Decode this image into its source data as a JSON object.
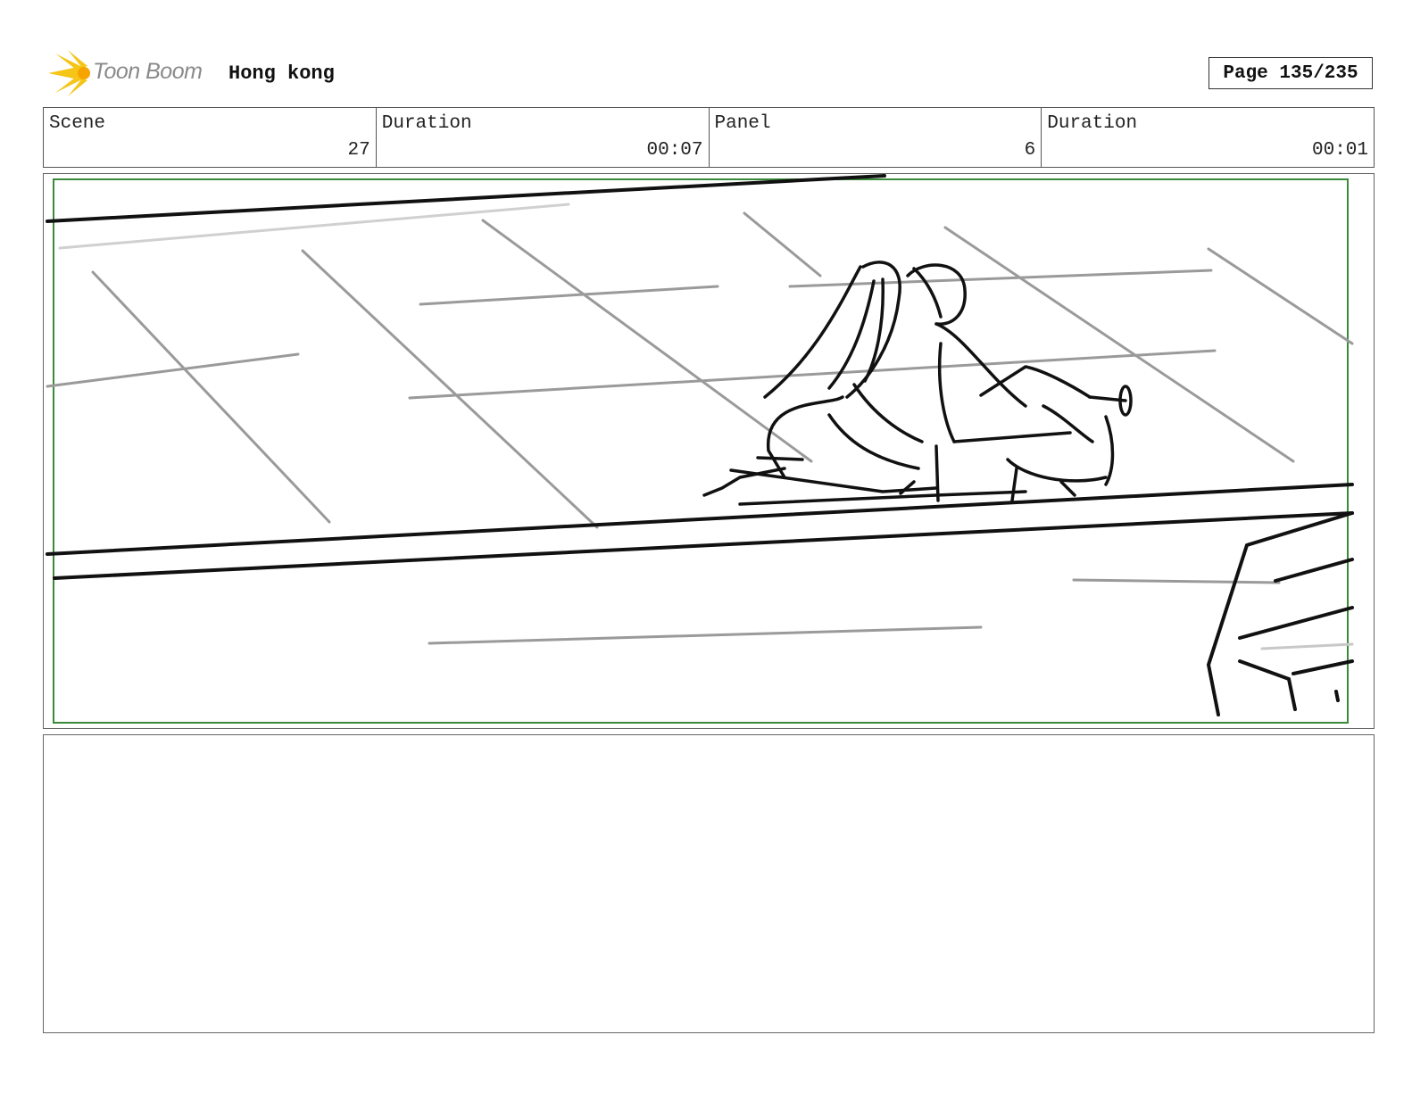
{
  "header": {
    "logo_text": "Toon Boom",
    "project_title": "Hong kong",
    "page_label": "Page 135/235"
  },
  "info": [
    {
      "label": "Scene",
      "value": "27"
    },
    {
      "label": "Duration",
      "value": "00:07"
    },
    {
      "label": "Panel",
      "value": "6"
    },
    {
      "label": "Duration",
      "value": "00:01"
    }
  ],
  "colors": {
    "safe_frame": "#3a8a3a",
    "logo_flare": "#f5c518",
    "sketch_dark": "#111111",
    "sketch_light": "#9a9a9a"
  },
  "panel": {
    "description_icon": "storyboard-sketch"
  },
  "notes": {
    "text": ""
  }
}
